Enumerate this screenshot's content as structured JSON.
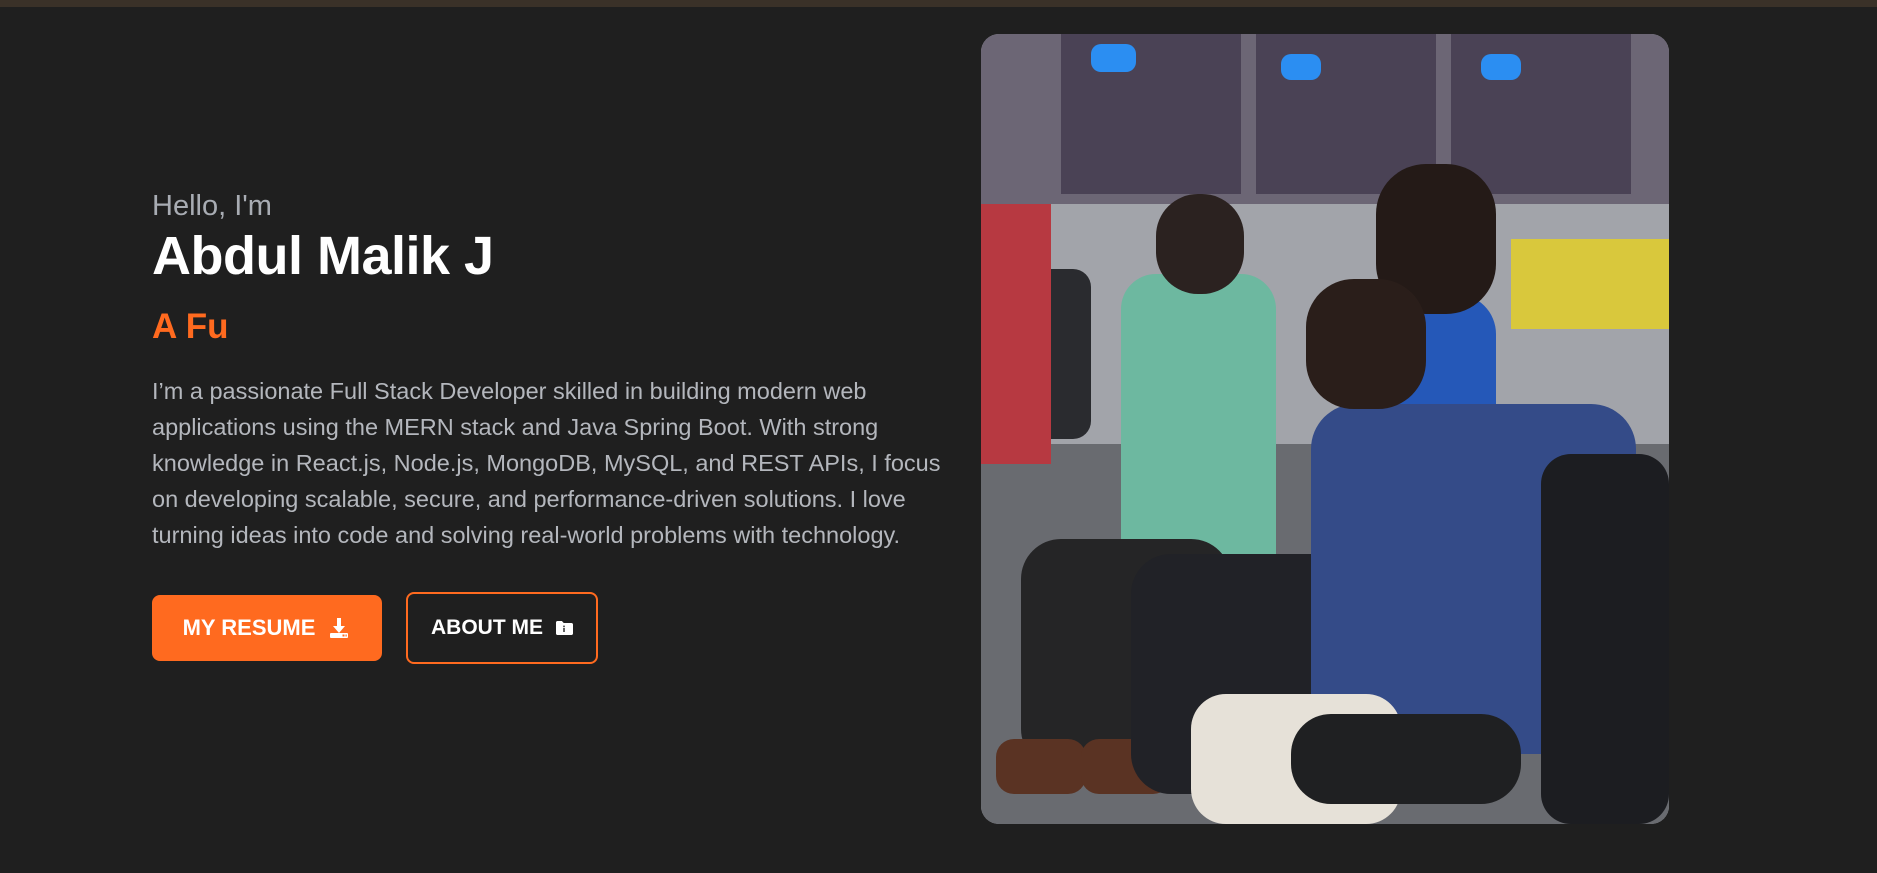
{
  "hero": {
    "greeting": "Hello, I'm",
    "name": "Abdul Malik J",
    "typed_role": "A Fu",
    "bio": "I’m a passionate Full Stack Developer skilled in building modern web applications using the MERN stack and Java Spring Boot. With strong knowledge in React.js, Node.js, MongoDB, MySQL, and REST APIs, I focus on developing scalable, secure, and performance-driven solutions. I love turning ideas into code and solving real-world problems with technology.",
    "buttons": {
      "resume_label": "MY RESUME",
      "resume_icon": "download-icon",
      "about_label": "ABOUT ME",
      "about_icon": "folder-info-icon"
    },
    "photo": {
      "alt": "Group of people in discussion at an event",
      "icon": "photo"
    }
  },
  "colors": {
    "background": "#1f1f1f",
    "accent": "#ff6a1f",
    "heading": "#ffffff",
    "muted": "#b4b7bd"
  }
}
